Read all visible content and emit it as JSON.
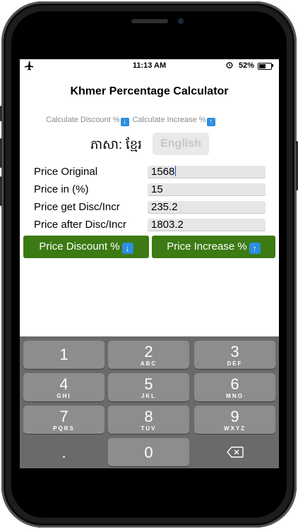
{
  "status": {
    "time": "11:13 AM",
    "battery": "52%"
  },
  "app": {
    "title": "Khmer Percentage Calculator"
  },
  "links": {
    "discount": "Calculate Discount %",
    "increase": "Calculate Increase %"
  },
  "language": {
    "label": "ភាសា: ខ្មែរ",
    "english": "English"
  },
  "fields": [
    {
      "label": "Price Original",
      "value": "1568"
    },
    {
      "label": "Price in (%)",
      "value": "15"
    },
    {
      "label": "Price get Disc/Incr",
      "value": "235.2"
    },
    {
      "label": "Price after Disc/Incr",
      "value": "1803.2"
    }
  ],
  "buttons": {
    "discount": "Price Discount %",
    "increase": "Price Increase %"
  },
  "icons": {
    "down": "arrow-down-icon",
    "up": "arrow-up-icon",
    "plane": "airplane-icon",
    "alarm": "alarm-icon",
    "backspace": "backspace-icon"
  },
  "keypad": {
    "keys": [
      {
        "num": "1",
        "letters": ""
      },
      {
        "num": "2",
        "letters": "ABC"
      },
      {
        "num": "3",
        "letters": "DEF"
      },
      {
        "num": "4",
        "letters": "GHI"
      },
      {
        "num": "5",
        "letters": "JKL"
      },
      {
        "num": "6",
        "letters": "MNO"
      },
      {
        "num": "7",
        "letters": "PQRS"
      },
      {
        "num": "8",
        "letters": "TUV"
      },
      {
        "num": "9",
        "letters": "WXYZ"
      }
    ],
    "dot": ".",
    "zero": "0"
  },
  "colors": {
    "green_button": "#3c7a14",
    "icon_blue": "#2d8de0",
    "keypad_bg": "#6a6a6a",
    "key_bg": "#8d8d8d"
  }
}
